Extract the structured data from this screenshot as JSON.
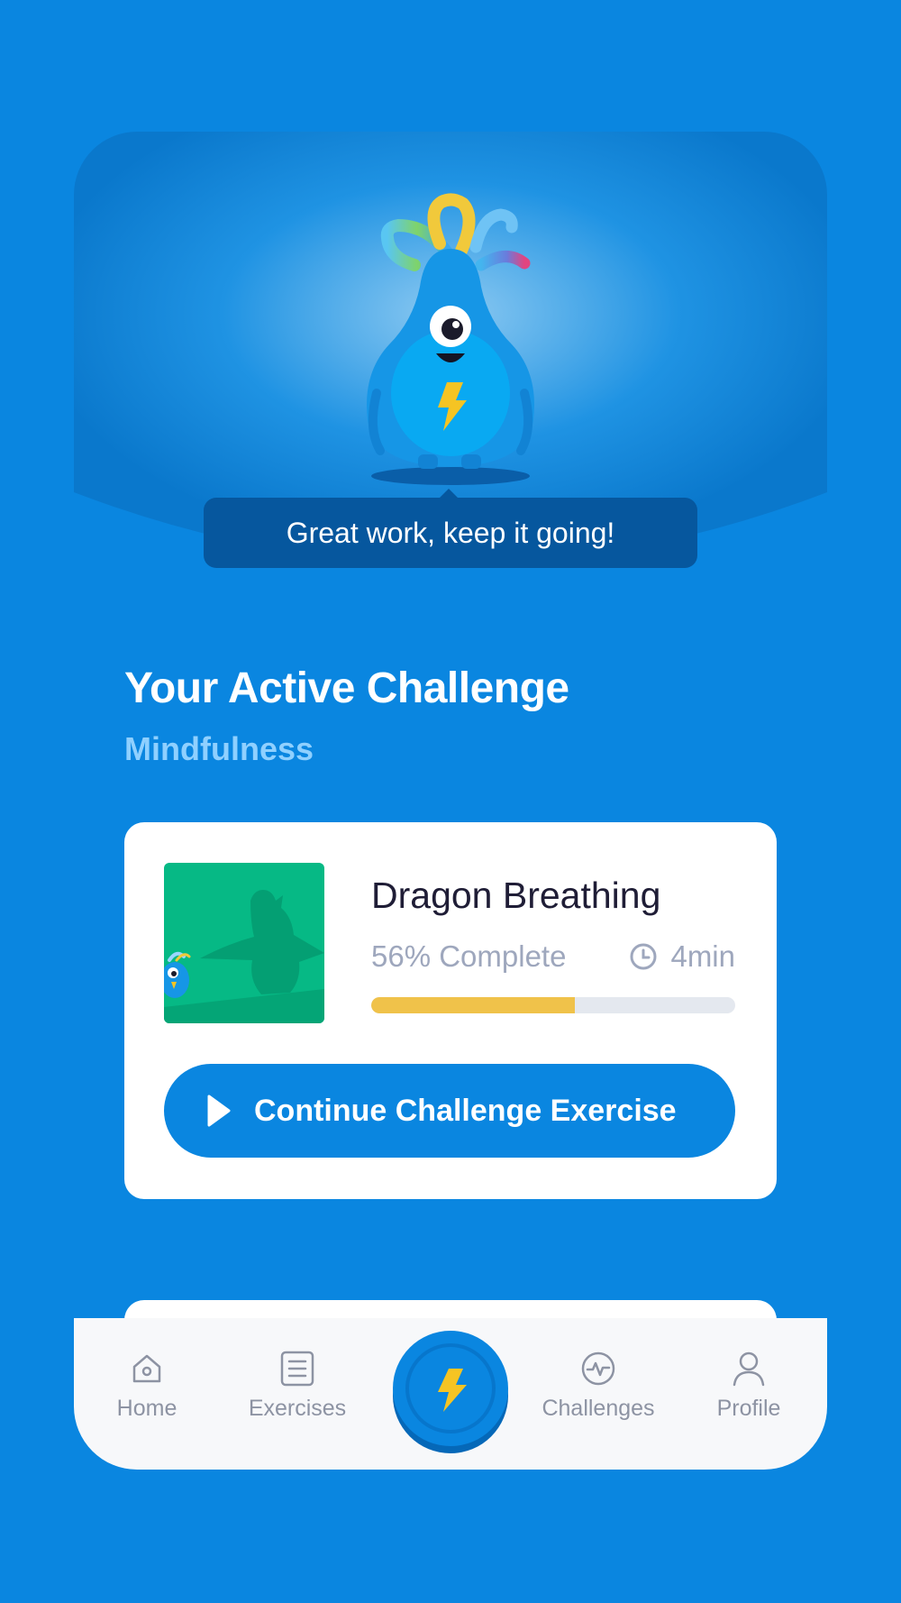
{
  "mascot": {
    "speech_bubble": "Great work, keep it going!"
  },
  "challenge": {
    "heading": "Your Active Challenge",
    "category": "Mindfulness"
  },
  "exercise": {
    "title": "Dragon Breathing",
    "progress_label": "56% Complete",
    "progress_value": 0.56,
    "duration": "4min",
    "cta_label": "Continue Challenge Exercise"
  },
  "nav": {
    "items": [
      {
        "label": "Home",
        "icon": "home-icon"
      },
      {
        "label": "Exercises",
        "icon": "list-icon"
      },
      {
        "label": "",
        "icon": "lightning-icon"
      },
      {
        "label": "Challenges",
        "icon": "activity-icon"
      },
      {
        "label": "Profile",
        "icon": "user-icon"
      }
    ]
  },
  "colors": {
    "background": "#0a86e0",
    "accent_yellow": "#f0c24a",
    "bubble": "#06579e",
    "thumbnail_green": "#06b985"
  }
}
